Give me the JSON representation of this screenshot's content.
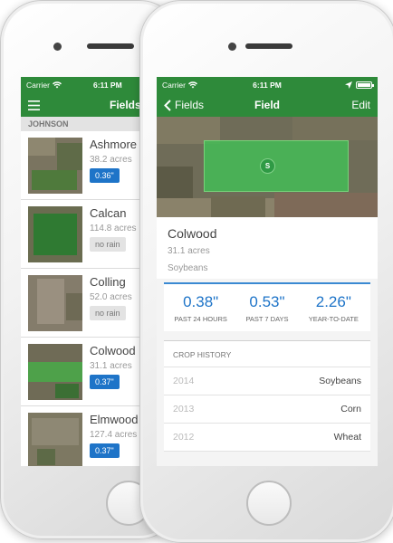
{
  "back": {
    "status": {
      "carrier": "Carrier",
      "time": "6:11 PM"
    },
    "nav": {
      "title": "Fields"
    },
    "section": "JOHNSON",
    "items": [
      {
        "name": "Ashmore",
        "acres": "38.2 acres",
        "badge": "0.36\"",
        "badge_type": "blue"
      },
      {
        "name": "Calcan",
        "acres": "114.8 acres",
        "badge": "no rain",
        "badge_type": "gray"
      },
      {
        "name": "Colling",
        "acres": "52.0 acres",
        "badge": "no rain",
        "badge_type": "gray"
      },
      {
        "name": "Colwood",
        "acres": "31.1 acres",
        "badge": "0.37\"",
        "badge_type": "blue"
      },
      {
        "name": "Elmwood",
        "acres": "127.4 acres",
        "badge": "0.37\"",
        "badge_type": "blue"
      }
    ]
  },
  "front": {
    "status": {
      "carrier": "Carrier",
      "time": "6:11 PM"
    },
    "nav": {
      "back_label": "Fields",
      "title": "Field",
      "edit_label": "Edit"
    },
    "map": {
      "marker_label": "S"
    },
    "field": {
      "name": "Colwood",
      "acres": "31.1 acres",
      "crop": "Soybeans"
    },
    "rainfall": [
      {
        "value": "0.38\"",
        "label": "PAST 24 HOURS"
      },
      {
        "value": "0.53\"",
        "label": "PAST 7 DAYS"
      },
      {
        "value": "2.26\"",
        "label": "YEAR-TO-DATE"
      }
    ],
    "crop_history": {
      "title": "CROP HISTORY",
      "rows": [
        {
          "year": "2014",
          "crop": "Soybeans"
        },
        {
          "year": "2013",
          "crop": "Corn"
        },
        {
          "year": "2012",
          "crop": "Wheat"
        }
      ]
    }
  },
  "colors": {
    "brand_green": "#2e8a3a",
    "accent_blue": "#1e74c8"
  }
}
